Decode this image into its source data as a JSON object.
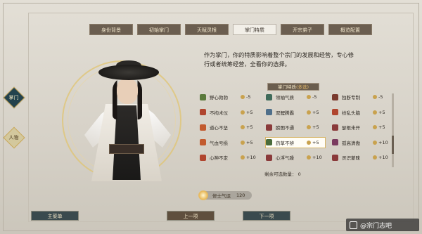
{
  "sidenav": {
    "items": [
      {
        "label": "掌门",
        "state": "active"
      },
      {
        "label": "人物",
        "state": "normal"
      }
    ]
  },
  "tabs": [
    {
      "label": "身份背景",
      "active": false
    },
    {
      "label": "初始掌门",
      "active": false
    },
    {
      "label": "天赋灵根",
      "active": false
    },
    {
      "label": "掌门特质",
      "active": true
    },
    {
      "label": "开宗弟子",
      "active": false
    },
    {
      "label": "概览配置",
      "active": false
    }
  ],
  "description": {
    "line1": "作为掌门，你的特质影响着整个宗门的发展和经营，专心修",
    "line2": "行或者统筹经营，全看你的选择。"
  },
  "traits": {
    "title": "掌门特质",
    "multi": "(多选)",
    "items": [
      {
        "name": "野心勃勃",
        "cost": "-5",
        "color": "#5b7a3c"
      },
      {
        "name": "领袖气质",
        "cost": "-5",
        "color": "#3f6b5a"
      },
      {
        "name": "独断专制",
        "cost": "-5",
        "color": "#7a3a2e"
      },
      {
        "name": "不拘术仪",
        "cost": "+5",
        "color": "#b0452e"
      },
      {
        "name": "双鲤腾霸",
        "cost": "+5",
        "color": "#4f6f8a"
      },
      {
        "name": "纷乱头脑",
        "cost": "+5",
        "color": "#b0452e"
      },
      {
        "name": "道心不坚",
        "cost": "+5",
        "color": "#c25a2e"
      },
      {
        "name": "膀图不通",
        "cost": "+5",
        "color": "#8a3a3a"
      },
      {
        "name": "瑟根未开",
        "cost": "+5",
        "color": "#8a3a3a"
      },
      {
        "name": "气血亏损",
        "cost": "+5",
        "color": "#c25a2e"
      },
      {
        "name": "药草不辨",
        "cost": "+5",
        "color": "#4a6b3a"
      },
      {
        "name": "孤高清傲",
        "cost": "+10",
        "color": "#7a3a5e"
      },
      {
        "name": "心神不定",
        "cost": "+10",
        "color": "#b0452e"
      },
      {
        "name": "心浮气躁",
        "cost": "+10",
        "color": "#8a3a3a"
      },
      {
        "name": "灵识蒙昧",
        "cost": "+10",
        "color": "#8a3a3a"
      }
    ],
    "remaining_label": "剩余可选数量：",
    "remaining_value": "0"
  },
  "points": {
    "label": "修士气运",
    "value": "120"
  },
  "buttons": {
    "main_menu": "主菜单",
    "prev": "上一项",
    "next": "下一项"
  },
  "watermark": "@宗门志吧"
}
